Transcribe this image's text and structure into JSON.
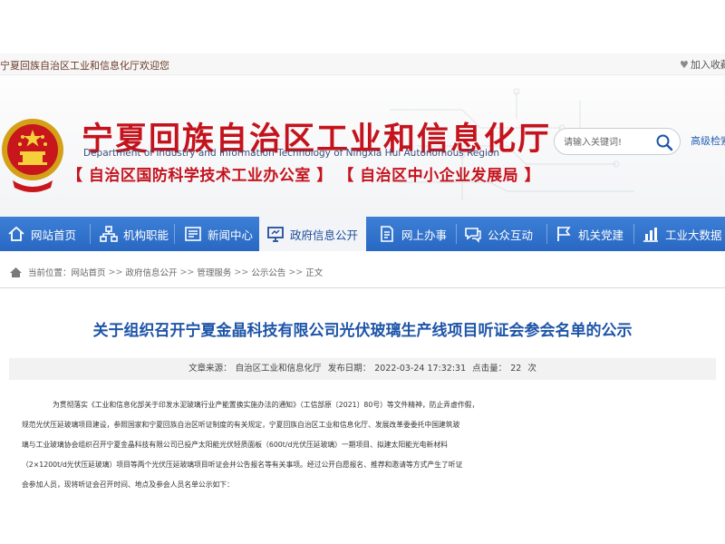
{
  "topbar": {
    "welcome": "宁夏回族自治区工业和信息化厅欢迎您",
    "favorite_label": "加入收藏"
  },
  "header": {
    "title_cn": "宁夏回族自治区工业和信息化厅",
    "title_en": "Department of Industry and Information Technology of Ningxia Hui Autonomous Region",
    "subtitle": "【 自治区国防科学技术工业办公室 】 【 自治区中小企业发展局 】",
    "search_placeholder": "请输入关键词!",
    "advanced_search": "高级检索"
  },
  "nav": {
    "items": [
      {
        "label": "网站首页",
        "icon": "home-icon"
      },
      {
        "label": "机构职能",
        "icon": "org-chart-icon"
      },
      {
        "label": "新闻中心",
        "icon": "newspaper-icon"
      },
      {
        "label": "政府信息公开",
        "icon": "monitor-icon",
        "active": true
      },
      {
        "label": "网上办事",
        "icon": "document-icon"
      },
      {
        "label": "公众互动",
        "icon": "chat-icon"
      },
      {
        "label": "机关党建",
        "icon": "flag-icon"
      },
      {
        "label": "工业大数据",
        "icon": "chart-icon"
      }
    ]
  },
  "breadcrumb": {
    "prefix": "当前位置：",
    "items": [
      "网站首页",
      "政府信息公开",
      "管理服务",
      "公示公告",
      "正文"
    ],
    "separator": ">>"
  },
  "article": {
    "title": "关于组织召开宁夏金晶科技有限公司光伏玻璃生产线项目听证会参会名单的公示",
    "meta": {
      "source_label": "文章来源：",
      "source": "自治区工业和信息化厅",
      "date_label": "发布日期：",
      "date": "2022-03-24 17:32:31",
      "hits_label": "点击量：",
      "hits": "22",
      "hits_unit": "次"
    },
    "body_lines": [
      "为贯彻落实《工业和信息化部关于印发水泥玻璃行业产能置换实施办法的通知》（工信部原〔2021〕80号）等文件精神，防止弄虚作假，",
      "规范光伏压延玻璃项目建设，参照国家和宁夏回族自治区听证制度的有关规定，宁夏回族自治区工业和信息化厅、发展改革委委托中国建筑玻",
      "璃与工业玻璃协会组织召开宁夏金晶科技有限公司已投产太阳能光伏轻质面板（600t/d光伏压延玻璃）一期项目、拟建太阳能光电新材料",
      "（2×1200t/d光伏压延玻璃）项目等两个光伏压延玻璃项目听证会并公告报名等有关事项。经过公开自愿报名、推荐和邀请等方式产生了听证",
      "会参加人员，现将听证会召开时间、地点及参会人员名单公示如下："
    ]
  },
  "colors": {
    "brand_red": "#c4131d",
    "nav_blue": "#2f72cc",
    "title_blue": "#1e55a8"
  }
}
